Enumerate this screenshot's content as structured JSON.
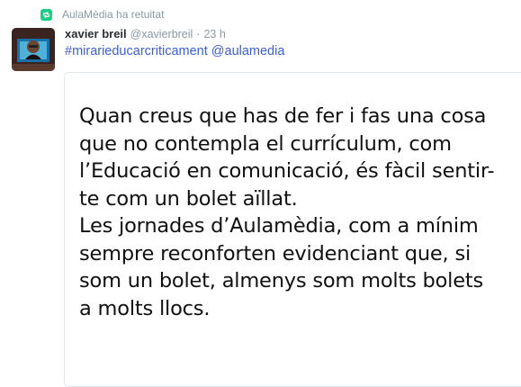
{
  "retweet": {
    "icon": "retweet-icon",
    "text": "AulaMèdia ha retuitat"
  },
  "tweet": {
    "avatar": "user-avatar",
    "name": "xavier breil",
    "handle": "@xavierbreil",
    "separator": "·",
    "time": "23 h",
    "hashtag": "#mirarieducarcriticament",
    "mention": "@aulamedia"
  },
  "card": {
    "lines": [
      "Quan creus que has de fer i fas una cosa",
      "que no contempla el currículum, com",
      "l’Educació en comunicació, és fàcil sentir-",
      "te com un bolet aïllat.",
      "Les jornades d’Aulamèdia, com a mínim",
      "sempre reconforten evidenciant que, si",
      "som un bolet, almenys som molts bolets",
      "a molts llocs."
    ]
  },
  "colors": {
    "retweet_green": "#19cf86",
    "link_blue": "#3b5fd9",
    "meta_gray": "#8899a6",
    "text_dark": "#292f33"
  }
}
